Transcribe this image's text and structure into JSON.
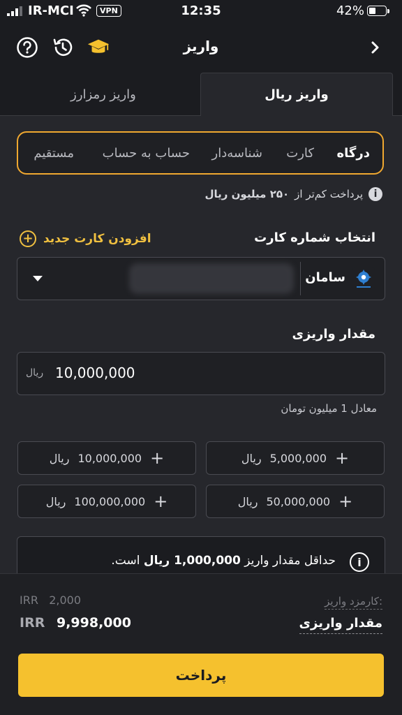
{
  "status_bar": {
    "carrier": "IR-MCI",
    "vpn": "VPN",
    "time": "12:35",
    "battery": "42%",
    "battery_level": 0.42
  },
  "header": {
    "title": "واریز",
    "icons": [
      "help-icon",
      "history-icon",
      "academy-icon",
      "chevron-right-icon"
    ]
  },
  "tabs": {
    "active": "واریز ریال",
    "inactive": "واریز رمزارز"
  },
  "methods": {
    "items": [
      "درگاه",
      "کارت",
      "شناسه‌دار",
      "حساب به حساب",
      "مستقیم"
    ],
    "active_index": 0
  },
  "info": {
    "text_pre": "پرداخت کم‌تر از",
    "text_bold": "۲۵۰ میلیون ریال"
  },
  "card": {
    "label": "انتخاب شماره کارت",
    "add_label": "افزودن کارت جدید",
    "bank_name": "سامان"
  },
  "amount": {
    "label": "مقدار واریزی",
    "value": "10,000,000",
    "unit": "ریال",
    "equivalent": "معادل 1 میلیون تومان"
  },
  "quick_amounts": [
    {
      "value": "5,000,000",
      "unit": "ریال"
    },
    {
      "value": "10,000,000",
      "unit": "ریال"
    },
    {
      "value": "50,000,000",
      "unit": "ریال"
    },
    {
      "value": "100,000,000",
      "unit": "ریال"
    }
  ],
  "notice": {
    "pre": "حداقل مقدار واریز",
    "bold": "1,000,000 ریال",
    "post": "است."
  },
  "summary": {
    "fee_label": "کارمزد واریز:",
    "fee_currency": "IRR",
    "fee_value": "2,000",
    "deposit_label": "مقدار واریزی",
    "deposit_currency": "IRR",
    "deposit_value": "9,998,000"
  },
  "pay_button": "پرداخت",
  "colors": {
    "accent": "#f5c12e",
    "highlight_border": "#f0a830",
    "background": "#1b1c20"
  }
}
